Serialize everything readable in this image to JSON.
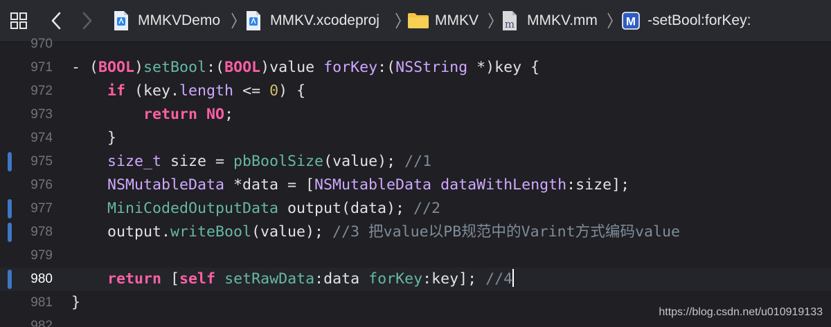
{
  "colors": {
    "keyword": "#fc5fa3",
    "type": "#d0a8ff",
    "call": "#67b7a4",
    "number": "#d0bf69",
    "comment": "#7f8c98",
    "plain": "#e3e3e3",
    "change_bar": "#3e78c4",
    "background": "#1f1f24"
  },
  "jumpbar": {
    "icons": {
      "related": "related-items-grid-icon",
      "back": "chevron-left-icon",
      "forward": "chevron-right-icon"
    },
    "crumbs": [
      {
        "label": "MMKVDemo",
        "icon": "xcode-project-icon"
      },
      {
        "label": "MMKV.xcodeproj",
        "icon": "xcode-project-icon"
      },
      {
        "label": "MMKV",
        "icon": "folder-icon"
      },
      {
        "label": "MMKV.mm",
        "icon": "objc-source-file-icon",
        "icon_letter": "m"
      },
      {
        "label": "-setBool:forKey:",
        "icon": "method-icon",
        "icon_letter": "M"
      }
    ]
  },
  "editor": {
    "current_line": 980,
    "lines": [
      {
        "num": "970",
        "tokens": []
      },
      {
        "num": "971",
        "tokens": [
          [
            "- (",
            "plain"
          ],
          [
            "BOOL",
            "kw"
          ],
          [
            ")",
            "plain"
          ],
          [
            "setBool",
            "call"
          ],
          [
            ":(",
            "plain"
          ],
          [
            "BOOL",
            "kw"
          ],
          [
            ")value ",
            "plain"
          ],
          [
            "forKey",
            "type"
          ],
          [
            ":(",
            "plain"
          ],
          [
            "NSString",
            "type"
          ],
          [
            " *)key {",
            "plain"
          ]
        ]
      },
      {
        "num": "972",
        "tokens": [
          [
            "    ",
            "plain"
          ],
          [
            "if",
            "kw"
          ],
          [
            " (key.",
            "plain"
          ],
          [
            "length",
            "type"
          ],
          [
            " <= ",
            "plain"
          ],
          [
            "0",
            "num"
          ],
          [
            ") {",
            "plain"
          ]
        ]
      },
      {
        "num": "973",
        "tokens": [
          [
            "        ",
            "plain"
          ],
          [
            "return",
            "kw"
          ],
          [
            " ",
            "plain"
          ],
          [
            "NO",
            "kw"
          ],
          [
            ";",
            "plain"
          ]
        ]
      },
      {
        "num": "974",
        "tokens": [
          [
            "    }",
            "plain"
          ]
        ]
      },
      {
        "num": "975",
        "changed": true,
        "tokens": [
          [
            "    ",
            "plain"
          ],
          [
            "size_t",
            "type"
          ],
          [
            " size = ",
            "plain"
          ],
          [
            "pbBoolSize",
            "call"
          ],
          [
            "(value); ",
            "plain"
          ],
          [
            "//1",
            "comment"
          ]
        ]
      },
      {
        "num": "976",
        "tokens": [
          [
            "    ",
            "plain"
          ],
          [
            "NSMutableData",
            "type"
          ],
          [
            " *data = [",
            "plain"
          ],
          [
            "NSMutableData",
            "type"
          ],
          [
            " ",
            "plain"
          ],
          [
            "dataWithLength",
            "type"
          ],
          [
            ":size];",
            "plain"
          ]
        ]
      },
      {
        "num": "977",
        "changed": true,
        "tokens": [
          [
            "    ",
            "plain"
          ],
          [
            "MiniCodedOutputData",
            "call"
          ],
          [
            " output(data); ",
            "plain"
          ],
          [
            "//2",
            "comment"
          ]
        ]
      },
      {
        "num": "978",
        "changed": true,
        "tokens": [
          [
            "    output.",
            "plain"
          ],
          [
            "writeBool",
            "call"
          ],
          [
            "(value); ",
            "plain"
          ],
          [
            "//3 把value以PB规范中的Varint方式编码value",
            "comment"
          ]
        ]
      },
      {
        "num": "979",
        "tokens": []
      },
      {
        "num": "980",
        "changed": true,
        "caret": true,
        "tokens": [
          [
            "    ",
            "plain"
          ],
          [
            "return",
            "kw"
          ],
          [
            " [",
            "plain"
          ],
          [
            "self",
            "kw"
          ],
          [
            " ",
            "plain"
          ],
          [
            "setRawData",
            "call"
          ],
          [
            ":data ",
            "plain"
          ],
          [
            "forKey",
            "call"
          ],
          [
            ":key]; ",
            "plain"
          ],
          [
            "//4",
            "comment"
          ]
        ]
      },
      {
        "num": "981",
        "tokens": [
          [
            "}",
            "plain"
          ]
        ]
      },
      {
        "num": "982",
        "tokens": []
      }
    ]
  },
  "watermark": "https://blog.csdn.net/u010919133"
}
